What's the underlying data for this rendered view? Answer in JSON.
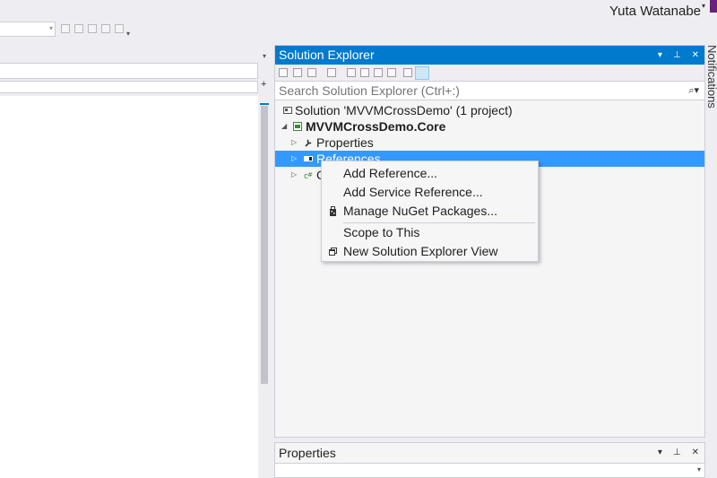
{
  "account": {
    "user_name": "Yuta Watanabe",
    "badge_color": "#68217a"
  },
  "solution_explorer": {
    "title": "Solution Explorer",
    "search_placeholder": "Search Solution Explorer (Ctrl+:)",
    "tree": [
      {
        "label": "Solution 'MVVMCrossDemo' (1 project)",
        "icon": "solution-icon"
      },
      {
        "label": "MVVMCrossDemo.Core",
        "icon": "csharp-project-icon",
        "bold": true,
        "expanded": true
      },
      {
        "label": "Properties",
        "icon": "wrench-icon"
      },
      {
        "label": "References",
        "icon": "references-icon",
        "selected": true
      },
      {
        "label": "C",
        "icon": "class-icon"
      }
    ]
  },
  "context_menu": {
    "items": [
      {
        "label": "Add Reference..."
      },
      {
        "label": "Add Service Reference..."
      },
      {
        "label": "Manage NuGet Packages...",
        "icon": "nuget-icon"
      },
      {
        "label": "Scope to This"
      },
      {
        "label": "New Solution Explorer View",
        "icon": "new-view-icon"
      }
    ]
  },
  "properties_panel": {
    "title": "Properties"
  },
  "notifications_tab": {
    "label": "Notifications"
  },
  "colors": {
    "accent": "#007acc",
    "selection": "#3399ff",
    "background": "#eeeef2"
  }
}
